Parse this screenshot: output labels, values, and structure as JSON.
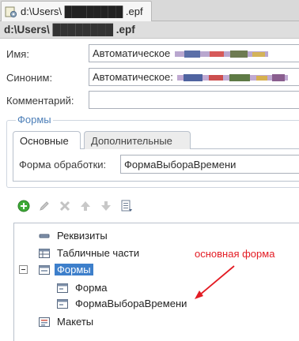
{
  "tab": {
    "title": "d:\\Users\\ ████████ .epf"
  },
  "window": {
    "title": "d:\\Users\\ ████████ .epf"
  },
  "fields": {
    "name": {
      "label": "Имя:",
      "value": "Автоматическое"
    },
    "synonym": {
      "label": "Синоним:",
      "value": "Автоматическое:"
    },
    "comment": {
      "label": "Комментарий:",
      "value": ""
    }
  },
  "forms_group": {
    "title": "Формы",
    "tabs": [
      "Основные",
      "Дополнительные"
    ],
    "processing_form": {
      "label": "Форма обработки:",
      "value": "ФормаВыбораВремени"
    }
  },
  "toolbar": {
    "icons": [
      "add-icon",
      "edit-icon",
      "delete-icon",
      "move-up-icon",
      "move-down-icon",
      "list-icon"
    ]
  },
  "tree": {
    "items": [
      {
        "label": "Реквизиты"
      },
      {
        "label": "Табличные части"
      },
      {
        "label": "Формы"
      },
      {
        "label": "Форма"
      },
      {
        "label": "ФормаВыбораВремени"
      },
      {
        "label": "Макеты"
      }
    ]
  },
  "annotation": {
    "text": "основная форма",
    "color": "#e31b23"
  },
  "colors": {
    "selection": "#3d7fcb",
    "group_title": "#4d7fb8",
    "add_button": "#3eab37"
  }
}
